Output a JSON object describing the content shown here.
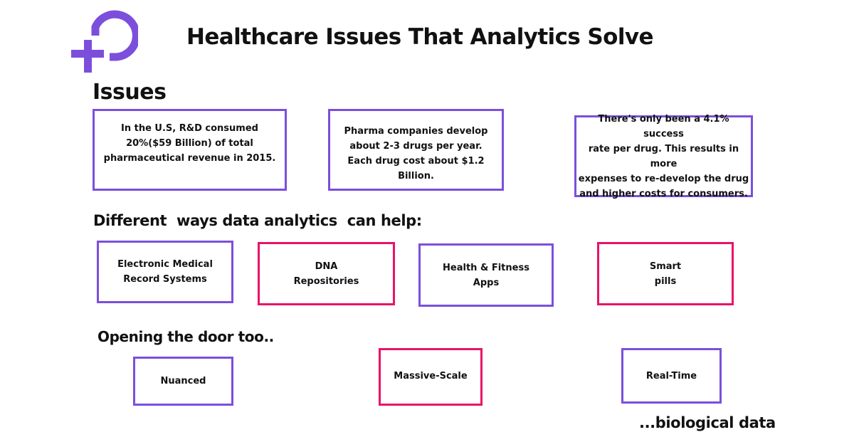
{
  "logo": {
    "icon": "plus-loop-logo-icon",
    "color": "#7b4fdc"
  },
  "title": "Healthcare Issues That Analytics Solve",
  "colors": {
    "purple": "#7b4fdc",
    "pink": "#ea1268"
  },
  "issues": {
    "heading": "Issues",
    "items": [
      {
        "text": "In the U.S, R&D consumed\n20%($59 Billion) of total\npharmaceutical revenue in 2015.",
        "border": "purple"
      },
      {
        "text": "Pharma  companies develop\nabout 2-3 drugs per year.\nEach drug cost about $1.2\nBillion.",
        "border": "purple"
      },
      {
        "text": "There's only been a 4.1% success\nrate per drug. This results in more\nexpenses to re-develop the drug\nand higher costs for consumers.",
        "border": "purple"
      }
    ]
  },
  "ways": {
    "heading": "Different  ways data analytics  can help:",
    "items": [
      {
        "text": "Electronic Medical\nRecord Systems",
        "border": "purple"
      },
      {
        "text": "DNA\nRepositories",
        "border": "pink"
      },
      {
        "text": "Health & Fitness\nApps",
        "border": "purple"
      },
      {
        "text": "Smart\npills",
        "border": "pink"
      }
    ]
  },
  "door": {
    "heading": "Opening the door too..",
    "items": [
      {
        "text": "Nuanced",
        "border": "purple"
      },
      {
        "text": "Massive-Scale",
        "border": "pink"
      },
      {
        "text": "Real-Time",
        "border": "purple"
      }
    ],
    "footer": "...biological data"
  }
}
